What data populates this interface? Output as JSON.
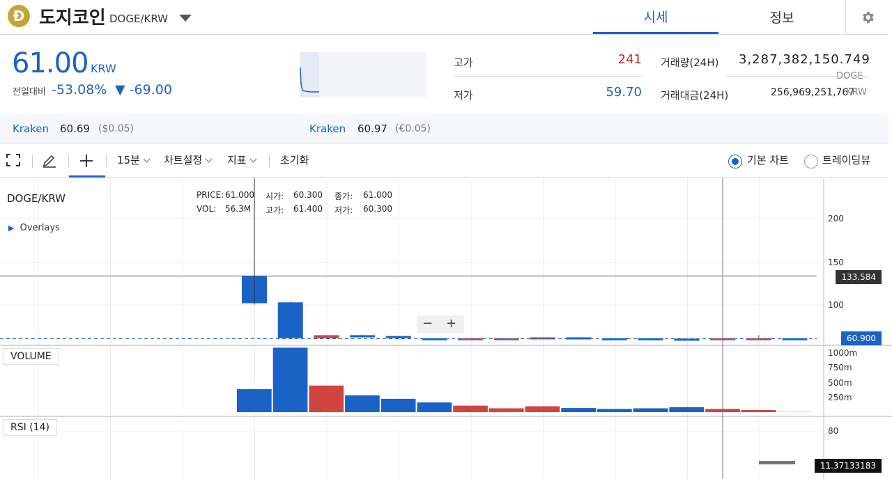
{
  "header": {
    "logo_glyph": "Ð",
    "coin_name": "도지코인",
    "pair": "DOGE/KRW",
    "tabs": [
      {
        "label": "시세"
      },
      {
        "label": "정보"
      }
    ],
    "accent": "#1b62c6",
    "logo_color": "#c2a633"
  },
  "price": {
    "current": "61.00",
    "unit": "KRW",
    "change_label": "전일대비",
    "change_pct": "-53.08%",
    "change_arrow": "▼",
    "change_amount": "-69.00"
  },
  "stats": {
    "high_label": "고가",
    "high_value": "241",
    "low_label": "저가",
    "low_value": "59.70",
    "volume_label": "거래량(24H)",
    "volume_value": "3,287,382,150.749",
    "volume_unit": "DOGE",
    "amount_label": "거래대금(24H)",
    "amount_value": "256,969,251,767",
    "amount_unit": "KRW"
  },
  "exchanges": [
    {
      "name": "Kraken",
      "value": "60.69",
      "sub": "($0.05)"
    },
    {
      "name": "Kraken",
      "value": "60.97",
      "sub": "(€0.05)"
    }
  ],
  "toolbar": {
    "interval": "15분",
    "chart_settings": "차트설정",
    "indicators": "지표",
    "reset": "초기화",
    "basic_chart": "기본 차트",
    "tradingview": "트레이딩뷰"
  },
  "chart": {
    "pair_label": "DOGE/KRW",
    "overlays_label": "Overlays",
    "volume_label": "VOLUME",
    "rsi_label": "RSI (14)",
    "tooltip": {
      "price_label": "PRICE:",
      "price_value": "61.000",
      "vol_label": "VOL:",
      "vol_value": "56.3M",
      "open_label": "시가:",
      "open_value": "60.300",
      "close_label": "종가:",
      "close_value": "61.000",
      "high_label": "고가:",
      "high_value": "61.400",
      "low_label": "저가:",
      "low_value": "60.300"
    },
    "price_ticks": [
      "200",
      "150",
      "100"
    ],
    "volume_ticks": [
      "1000m",
      "750m",
      "500m",
      "250m"
    ],
    "rsi_ticks": [
      "80"
    ],
    "crosshair_price": "133.584",
    "last_price": "60.900",
    "rsi_value": "11.37133183",
    "zoom_minus": "−",
    "zoom_plus": "+",
    "up_color": "#d0453f",
    "down_color": "#1b62c6"
  },
  "chart_data": {
    "type": "bar",
    "title": "DOGE/KRW",
    "candles": [
      {
        "open": 133.6,
        "close": 102,
        "high": 133.6,
        "low": 100
      },
      {
        "open": 103,
        "close": 61.5,
        "high": 104,
        "low": 60.5
      },
      {
        "open": 61.3,
        "close": 65,
        "high": 65,
        "low": 61
      },
      {
        "open": 65,
        "close": 62.5,
        "high": 65.5,
        "low": 62
      },
      {
        "open": 64,
        "close": 61.5,
        "high": 64,
        "low": 61
      },
      {
        "open": 61.5,
        "close": 60.5,
        "high": 61.5,
        "low": 60.3
      },
      {
        "open": 60.5,
        "close": 61.5,
        "high": 61.5,
        "low": 60.3
      },
      {
        "open": 60.5,
        "close": 61.5,
        "high": 61.5,
        "low": 60.3
      },
      {
        "open": 60.8,
        "close": 62.5,
        "high": 62.5,
        "low": 60.8
      },
      {
        "open": 62.5,
        "close": 60.8,
        "high": 62.5,
        "low": 60.5
      },
      {
        "open": 61.5,
        "close": 60.5,
        "high": 61.5,
        "low": 60.3
      },
      {
        "open": 61.5,
        "close": 60.5,
        "high": 61.5,
        "low": 60.3
      },
      {
        "open": 61,
        "close": 59.7,
        "high": 61,
        "low": 59.7
      },
      {
        "open": 60.3,
        "close": 61.5,
        "high": 61.5,
        "low": 60.3
      },
      {
        "open": 60.3,
        "close": 61.5,
        "high": 65,
        "low": 60.3
      },
      {
        "open": 61.5,
        "close": 60.9,
        "high": 61.5,
        "low": 60.5
      }
    ],
    "volumes": [
      390,
      1090,
      450,
      285,
      225,
      165,
      110,
      65,
      100,
      70,
      55,
      65,
      85,
      55,
      35,
      5
    ],
    "volume_unit": "m",
    "ylim": [
      55,
      250
    ],
    "volume_ylim": [
      0,
      1100
    ],
    "rsi_value": 11.37133183
  }
}
